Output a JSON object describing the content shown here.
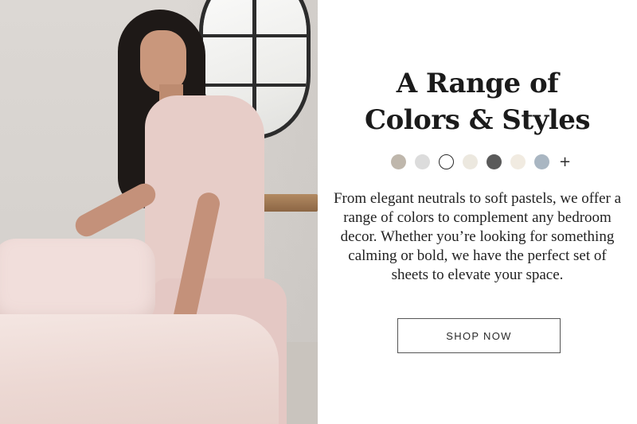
{
  "hero": {
    "title_line1": "A Range of",
    "title_line2": "Colors & Styles",
    "description": "From elegant neutrals to soft pastels, we offer a range of colors to complement any bedroom decor. Whether you’re looking for something calming or bold, we have the perfect set of sheets to elevate your space.",
    "cta_label": "SHOP NOW"
  },
  "swatches": [
    {
      "color": "#bfb7ac",
      "outlined": false
    },
    {
      "color": "#dcdcdc",
      "outlined": false
    },
    {
      "color": "#ffffff",
      "outlined": true
    },
    {
      "color": "#ece8df",
      "outlined": false
    },
    {
      "color": "#5a5a5a",
      "outlined": false
    },
    {
      "color": "#f1ebe1",
      "outlined": false
    },
    {
      "color": "#a9b6c2",
      "outlined": false
    }
  ],
  "swatch_more_symbol": "+",
  "photo": {
    "icon": "lifestyle-photo",
    "colors": {
      "wall": "#d8d4d0",
      "shirt": "#e7cdc8",
      "bedding": "#f1dedb",
      "hair": "#1e1917"
    }
  }
}
